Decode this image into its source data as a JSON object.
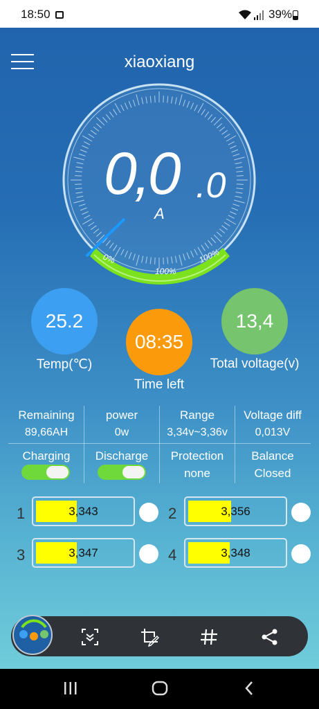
{
  "status_bar": {
    "time": "18:50",
    "battery": "39%"
  },
  "header": {
    "title": "xiaoxiang"
  },
  "gauge": {
    "current_main": "0,0",
    "current_decimal": ".0",
    "unit": "A",
    "scale_start": "0%",
    "scale_mid": "100%",
    "scale_end": "100%",
    "accent_color": "#7ce21e"
  },
  "metrics": {
    "temp": {
      "value": "25.2",
      "label": "Temp(℃)",
      "color": "#3d9ff2"
    },
    "time_left": {
      "value": "08:35",
      "label": "Time left",
      "color": "#fb9b0c"
    },
    "voltage": {
      "value": "13,4",
      "label": "Total voltage(v)",
      "color": "#76c46e"
    }
  },
  "stats": [
    {
      "label": "Remaining",
      "value": "89,66AH"
    },
    {
      "label": "power",
      "value": "0w"
    },
    {
      "label": "Range",
      "value": "3,34v~3,36v"
    },
    {
      "label": "Voltage diff",
      "value": "0,013V"
    }
  ],
  "controls": {
    "charging": {
      "label": "Charging",
      "on": true
    },
    "discharge": {
      "label": "Discharge",
      "on": true
    },
    "protection": {
      "label": "Protection",
      "value": "none"
    },
    "balance": {
      "label": "Balance",
      "value": "Closed"
    }
  },
  "cells": [
    {
      "number": "1",
      "voltage": "3,343",
      "level": 0.43
    },
    {
      "number": "2",
      "voltage": "3,356",
      "level": 0.45
    },
    {
      "number": "3",
      "voltage": "3,347",
      "level": 0.43
    },
    {
      "number": "4",
      "voltage": "3,348",
      "level": 0.44
    }
  ],
  "toolbar": {
    "icons": [
      "scroll-capture-icon",
      "draw-crop-icon",
      "hashtag-icon",
      "share-icon"
    ]
  },
  "navbar": {
    "icons": [
      "recents-icon",
      "home-icon",
      "back-icon"
    ]
  }
}
